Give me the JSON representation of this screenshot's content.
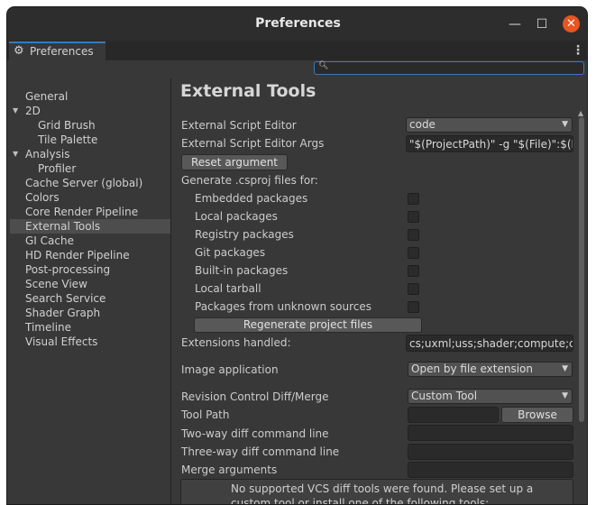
{
  "window": {
    "title": "Preferences",
    "minimize_glyph": "—",
    "maximize_glyph": "☐",
    "close_glyph": "✕"
  },
  "tab": {
    "label": "Preferences",
    "icon": "gear-icon"
  },
  "search": {
    "value": "",
    "placeholder": ""
  },
  "sidebar": {
    "items": [
      {
        "label": "General",
        "indent": 0,
        "selected": false,
        "expandable": false
      },
      {
        "label": "2D",
        "indent": 0,
        "selected": false,
        "expandable": true
      },
      {
        "label": "Grid Brush",
        "indent": 1,
        "selected": false,
        "expandable": false
      },
      {
        "label": "Tile Palette",
        "indent": 1,
        "selected": false,
        "expandable": false
      },
      {
        "label": "Analysis",
        "indent": 0,
        "selected": false,
        "expandable": true
      },
      {
        "label": "Profiler",
        "indent": 1,
        "selected": false,
        "expandable": false
      },
      {
        "label": "Cache Server (global)",
        "indent": 0,
        "selected": false,
        "expandable": false
      },
      {
        "label": "Colors",
        "indent": 0,
        "selected": false,
        "expandable": false
      },
      {
        "label": "Core Render Pipeline",
        "indent": 0,
        "selected": false,
        "expandable": false
      },
      {
        "label": "External Tools",
        "indent": 0,
        "selected": true,
        "expandable": false
      },
      {
        "label": "GI Cache",
        "indent": 0,
        "selected": false,
        "expandable": false
      },
      {
        "label": "HD Render Pipeline",
        "indent": 0,
        "selected": false,
        "expandable": false
      },
      {
        "label": "Post-processing",
        "indent": 0,
        "selected": false,
        "expandable": false
      },
      {
        "label": "Scene View",
        "indent": 0,
        "selected": false,
        "expandable": false
      },
      {
        "label": "Search Service",
        "indent": 0,
        "selected": false,
        "expandable": false
      },
      {
        "label": "Shader Graph",
        "indent": 0,
        "selected": false,
        "expandable": false
      },
      {
        "label": "Timeline",
        "indent": 0,
        "selected": false,
        "expandable": false
      },
      {
        "label": "Visual Effects",
        "indent": 0,
        "selected": false,
        "expandable": false
      }
    ]
  },
  "main": {
    "title": "External Tools",
    "external_script_editor": {
      "label": "External Script Editor",
      "value": "code"
    },
    "external_script_editor_args": {
      "label": "External Script Editor Args",
      "value": "\"$(ProjectPath)\" -g \"$(File)\":$(L"
    },
    "reset_argument_label": "Reset argument",
    "generate_csproj_label": "Generate .csproj files for:",
    "packages": [
      {
        "label": "Embedded packages",
        "checked": false
      },
      {
        "label": "Local packages",
        "checked": false
      },
      {
        "label": "Registry packages",
        "checked": false
      },
      {
        "label": "Git packages",
        "checked": false
      },
      {
        "label": "Built-in packages",
        "checked": false
      },
      {
        "label": "Local tarball",
        "checked": false
      },
      {
        "label": "Packages from unknown sources",
        "checked": false
      }
    ],
    "regenerate_label": "Regenerate project files",
    "extensions_handled": {
      "label": "Extensions handled:",
      "value": "cs;uxml;uss;shader;compute;cgi"
    },
    "image_application": {
      "label": "Image application",
      "value": "Open by file extension"
    },
    "revision_control": {
      "label": "Revision Control Diff/Merge",
      "value": "Custom Tool"
    },
    "tool_path": {
      "label": "Tool Path",
      "value": "",
      "browse_label": "Browse"
    },
    "two_way_diff": {
      "label": "Two-way diff command line",
      "value": ""
    },
    "three_way_diff": {
      "label": "Three-way diff command line",
      "value": ""
    },
    "merge_arguments": {
      "label": "Merge arguments",
      "value": ""
    },
    "help_text": "No supported VCS diff tools were found. Please set up a custom tool or install one of the following tools:"
  }
}
